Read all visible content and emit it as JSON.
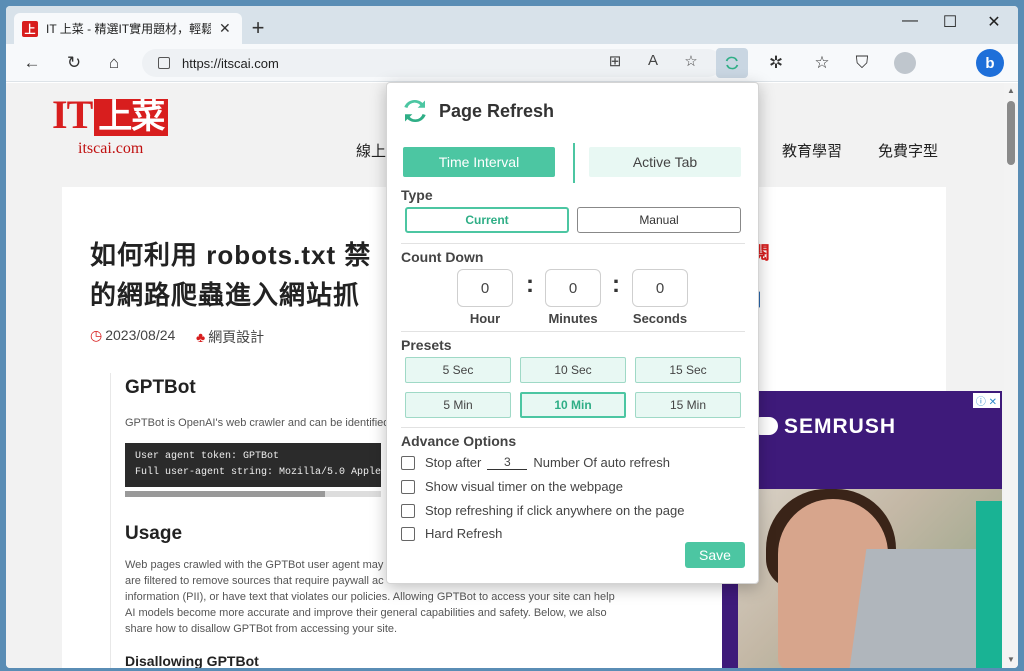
{
  "browser": {
    "tab_title": "IT 上菜 - 精選IT實用題材，輕鬆學",
    "tab_favicon": "上",
    "url": "https://itscai.com",
    "bing_label": "b"
  },
  "site": {
    "logo_it": "IT",
    "logo_cn": "上菜",
    "logo_sub": "itscai.com",
    "nav": [
      "線上",
      "教育學習",
      "免費字型"
    ]
  },
  "article": {
    "title_line1": "如何利用 robots.txt 禁",
    "title_line2": "的網路爬蟲進入網站抓",
    "date": "2023/08/24",
    "category": "網頁設計",
    "share_red": "閱",
    "shot": {
      "h_gptbot": "GPTBot",
      "intro": "GPTBot is OpenAI's web crawler and can be identified",
      "code_line1": "User agent token: GPTBot",
      "code_line2": "Full user-agent string: Mozilla/5.0 AppleW",
      "h_usage": "Usage",
      "usage_l1": "Web pages crawled with the GPTBot user agent may p",
      "usage_l2": "are filtered to remove sources that require paywall ac",
      "usage_l3": "information (PII), or have text that violates our policies. Allowing GPTBot to access your site can help",
      "usage_l4": "AI models become more accurate and improve their general capabilities and safety. Below, we also",
      "usage_l5": "share how to disallow GPTBot from accessing your site.",
      "h_disallow": "Disallowing GPTBot"
    }
  },
  "ad": {
    "brand": "SEMRUSH",
    "badge": "ⓘ ✕"
  },
  "popup": {
    "title": "Page Refresh",
    "mode_time": "Time Interval",
    "mode_active": "Active Tab",
    "type_label": "Type",
    "type_current": "Current",
    "type_manual": "Manual",
    "countdown_label": "Count Down",
    "hour_value": "0",
    "minutes_value": "0",
    "seconds_value": "0",
    "hour_caption": "Hour",
    "minutes_caption": "Minutes",
    "seconds_caption": "Seconds",
    "presets_label": "Presets",
    "presets": [
      "5 Sec",
      "10 Sec",
      "15 Sec",
      "5 Min",
      "10 Min",
      "15 Min"
    ],
    "active_preset": "10 Min",
    "advance_label": "Advance Options",
    "stop_after": "Stop after",
    "stop_value": "3",
    "stop_suffix": "Number Of auto refresh",
    "opt_visual": "Show visual timer on the webpage",
    "opt_click": "Stop refreshing if click anywhere on the page",
    "opt_hard": "Hard Refresh",
    "save": "Save"
  },
  "colors": {
    "accent": "#4cc6a2",
    "accent_light": "#e8f8f3",
    "brand_red": "#d81e1e",
    "ad_purple": "#3e1a7a"
  }
}
